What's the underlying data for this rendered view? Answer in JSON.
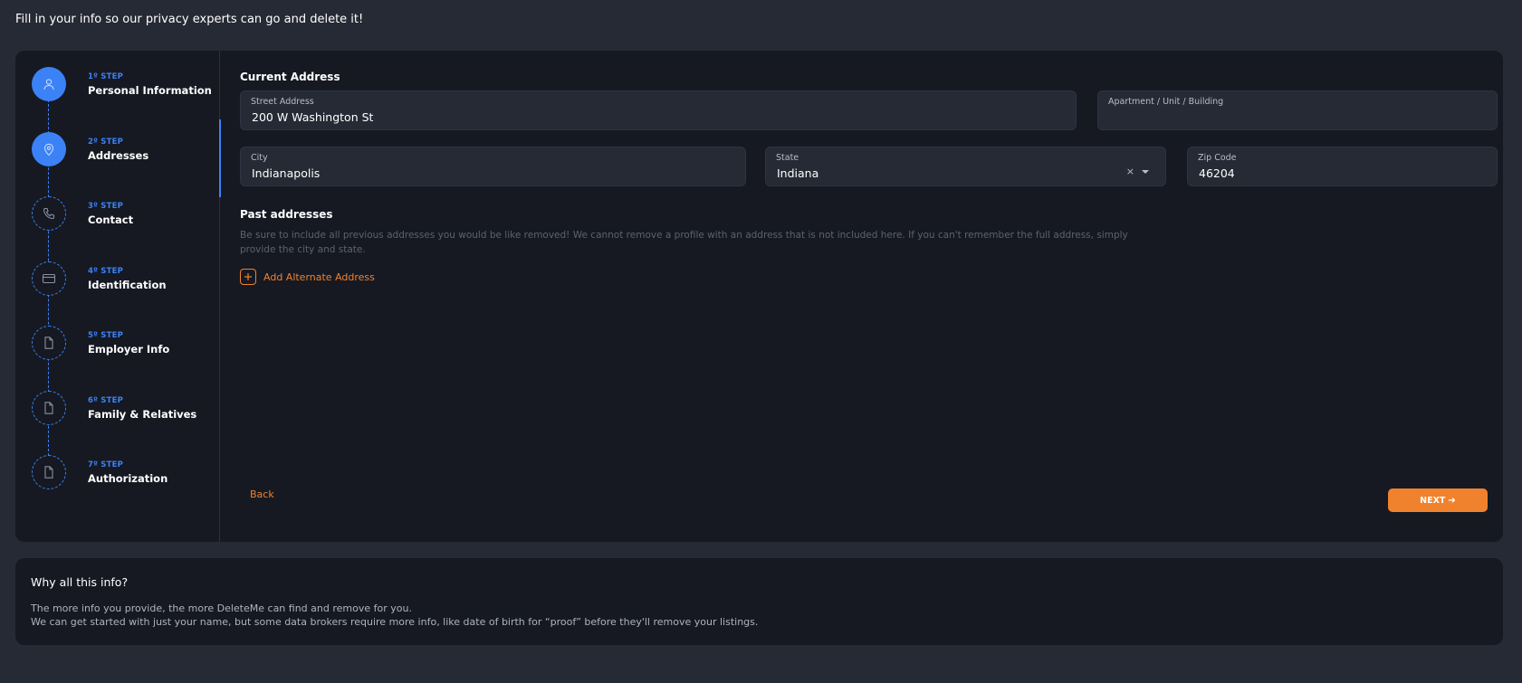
{
  "intro": "Fill in your info so our privacy experts can go and delete it!",
  "colors": {
    "accent": "#3b82f6",
    "action": "#f0822e",
    "panel": "#161922",
    "page": "#262a35"
  },
  "steps": [
    {
      "num": "1º STEP",
      "label": "Personal Information",
      "icon": "user-icon",
      "state": "done"
    },
    {
      "num": "2º STEP",
      "label": "Addresses",
      "icon": "location-pin-icon",
      "state": "active"
    },
    {
      "num": "3º STEP",
      "label": "Contact",
      "icon": "phone-icon",
      "state": "pending"
    },
    {
      "num": "4º STEP",
      "label": "Identification",
      "icon": "id-card-icon",
      "state": "pending"
    },
    {
      "num": "5º STEP",
      "label": "Employer Info",
      "icon": "document-icon",
      "state": "pending"
    },
    {
      "num": "6º STEP",
      "label": "Family & Relatives",
      "icon": "document-icon",
      "state": "pending"
    },
    {
      "num": "7º STEP",
      "label": "Authorization",
      "icon": "document-icon",
      "state": "pending"
    }
  ],
  "current_address": {
    "title": "Current Address",
    "street": {
      "label": "Street Address",
      "value": "200 W Washington St"
    },
    "apartment": {
      "label": "Apartment / Unit / Building",
      "value": ""
    },
    "city": {
      "label": "City",
      "value": "Indianapolis"
    },
    "state": {
      "label": "State",
      "value": "Indiana",
      "clear": "×"
    },
    "zip": {
      "label": "Zip Code",
      "value": "46204"
    }
  },
  "past_addresses": {
    "title": "Past addresses",
    "help": "Be sure to include all previous addresses you would be like removed! We cannot remove a profile with an address that is not included here. If you can't remember the full address, simply provide the city and state.",
    "add_label": "Add Alternate Address"
  },
  "nav": {
    "back": "Back",
    "next": "NEXT",
    "next_arrow": "➔"
  },
  "info": {
    "title": "Why all this info?",
    "line1": "The more info you provide, the more DeleteMe can find and remove for you.",
    "line2": "We can get started with just your name, but some data brokers require more info, like date of birth for “proof” before they'll remove your listings."
  }
}
